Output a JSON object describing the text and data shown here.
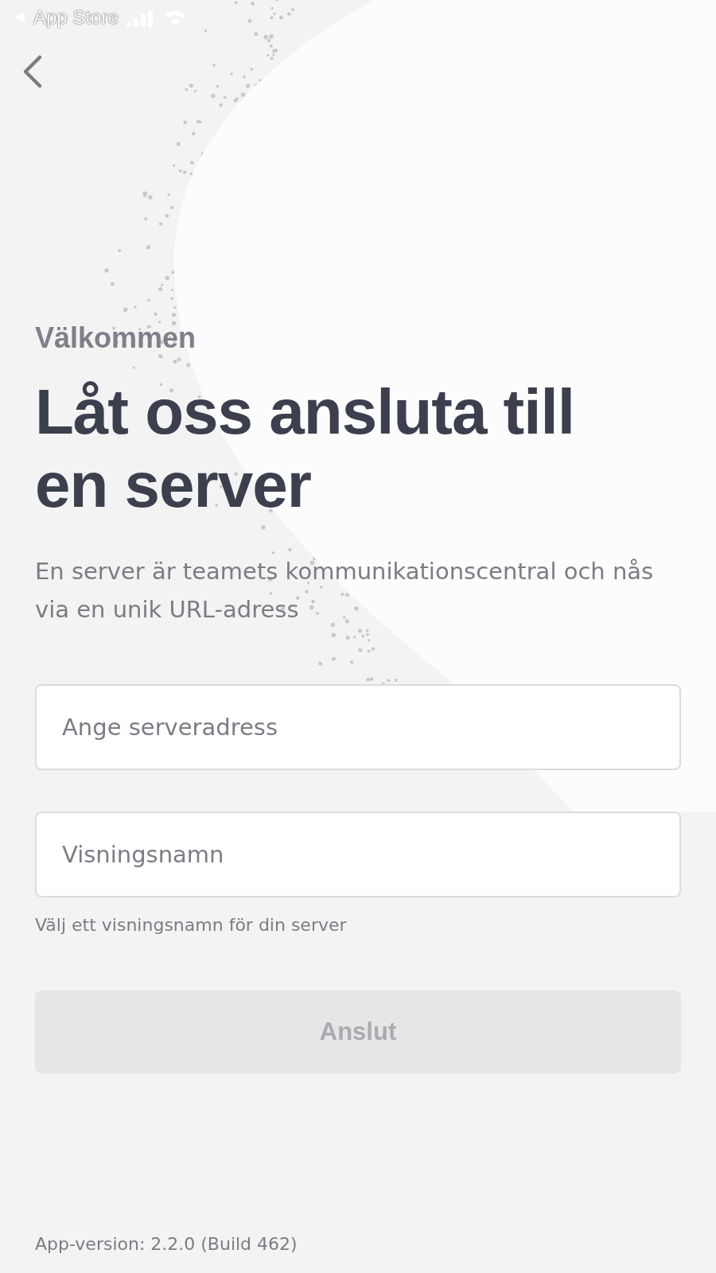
{
  "status_bar": {
    "back_label": "App Store"
  },
  "greeting": "Välkommen",
  "title": "Låt oss ansluta till en server",
  "description": "En server är teamets kommunikationscentral och nås via en unik URL-adress",
  "fields": [
    {
      "placeholder": "Ange serveradress"
    },
    {
      "placeholder": "Visningsnamn",
      "hint": "Välj ett visningsnamn för din server"
    }
  ],
  "connect_button": {
    "label": "Anslut",
    "disabled": true
  },
  "footer": "App-version: 2.2.0 (Build 462)"
}
